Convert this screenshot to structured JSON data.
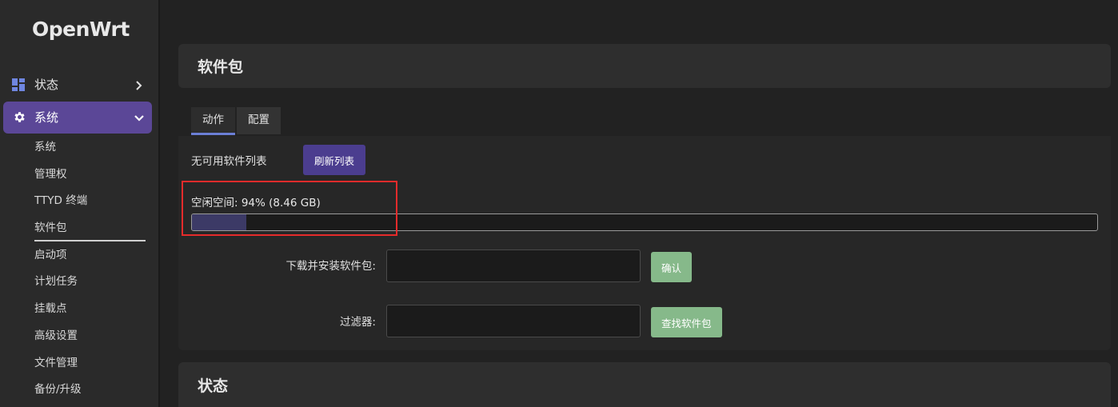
{
  "app": {
    "logo": "OpenWrt"
  },
  "sidebar": {
    "status_label": "状态",
    "system_label": "系统",
    "sub_items": [
      "系统",
      "管理权",
      "TTYD 终端",
      "软件包",
      "启动项",
      "计划任务",
      "挂载点",
      "高级设置",
      "文件管理",
      "备份/升级"
    ],
    "active_sub_item": "软件包"
  },
  "header": {
    "title": "软件包"
  },
  "tabs": [
    {
      "label": "动作",
      "active": true
    },
    {
      "label": "配置",
      "active": false
    }
  ],
  "actions": {
    "no_list_text": "无可用软件列表",
    "refresh_label": "刷新列表",
    "free_space_label": "空闲空间: 94% (8.46 GB)",
    "used_fraction": 0.06,
    "download_label": "下载并安装软件包:",
    "download_value": "",
    "confirm_label": "确认",
    "filter_label": "过滤器:",
    "filter_value": "",
    "find_label": "查找软件包"
  },
  "status_section": {
    "title": "状态"
  },
  "colors": {
    "accent": "#5b4797",
    "progress_fill": "#3c3a66",
    "green_button": "#86b98a",
    "highlight_border": "#e52b2b"
  }
}
